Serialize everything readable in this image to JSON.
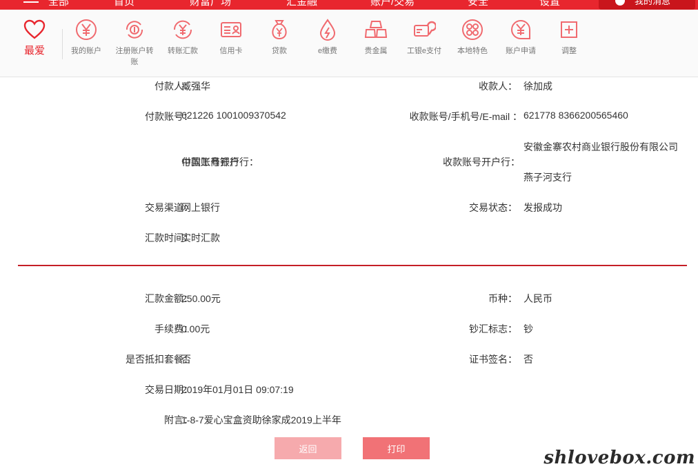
{
  "topnav": {
    "items": [
      "全部",
      "首页",
      "财富广场",
      "汇金融",
      "账户/交易",
      "安全",
      "设置"
    ],
    "right_tab": "我的消息"
  },
  "shortcuts": {
    "favorite_label": "最爱",
    "items": [
      {
        "label": "我的账户",
        "icon": "yen-coin-icon"
      },
      {
        "label": "注册账户转账",
        "icon": "register-transfer-icon"
      },
      {
        "label": "转账汇款",
        "icon": "transfer-icon"
      },
      {
        "label": "信用卡",
        "icon": "credit-card-icon"
      },
      {
        "label": "贷款",
        "icon": "loan-bag-icon"
      },
      {
        "label": "e缴费",
        "icon": "e-pay-drop-icon"
      },
      {
        "label": "贵金属",
        "icon": "gold-bars-icon"
      },
      {
        "label": "工银e支付",
        "icon": "e-payment-icon"
      },
      {
        "label": "本地特色",
        "icon": "local-feature-icon"
      },
      {
        "label": "账户申请",
        "icon": "account-apply-icon"
      },
      {
        "label": "调整",
        "icon": "adjust-plus-icon"
      }
    ]
  },
  "detail": {
    "payer_label": "付款人：",
    "payer_value": "臧强华",
    "payee_label": "收款人：",
    "payee_value": "徐加成",
    "payer_account_label": "付款账号：",
    "payer_account_value": "621226 1001009370542",
    "payee_account_label": "收款账号/手机号/E-mail ：",
    "payee_account_value": "621778 8366200565460",
    "payer_bank_label": "付款账号开户行：",
    "payer_bank_value": "中国工商银行",
    "payee_bank_label": "收款账号开户行：",
    "payee_bank_line1": "安徽金寨农村商业银行股份有限公司",
    "payee_bank_line2": "燕子河支行",
    "channel_label": "交易渠道：",
    "channel_value": "网上银行",
    "status_label": "交易状态：",
    "status_value": "发报成功",
    "remit_time_label": "汇款时间：",
    "remit_time_value": "实时汇款",
    "amount_label": "汇款金额：",
    "amount_value": "250.00元",
    "currency_label": "币种：",
    "currency_value": "人民币",
    "fee_label": "手续费：",
    "fee_value": "0.00元",
    "cash_flag_label": "钞汇标志：",
    "cash_flag_value": "钞",
    "package_label": "是否抵扣套餐：",
    "package_value": "否",
    "cert_sign_label": "证书签名：",
    "cert_sign_value": "否",
    "date_label": "交易日期：",
    "date_value": "2019年01月01日 09:07:19",
    "note_label": "附言：",
    "note_value": "1-8-7爱心宝盒资助徐家成2019上半年"
  },
  "buttons": {
    "back": "返回",
    "print": "打印"
  },
  "watermark": "shlovebox.com",
  "colors": {
    "brand_red": "#e8262e",
    "divider_red": "#c51f26",
    "back_button": "#f6aaad",
    "print_button": "#f17276"
  }
}
